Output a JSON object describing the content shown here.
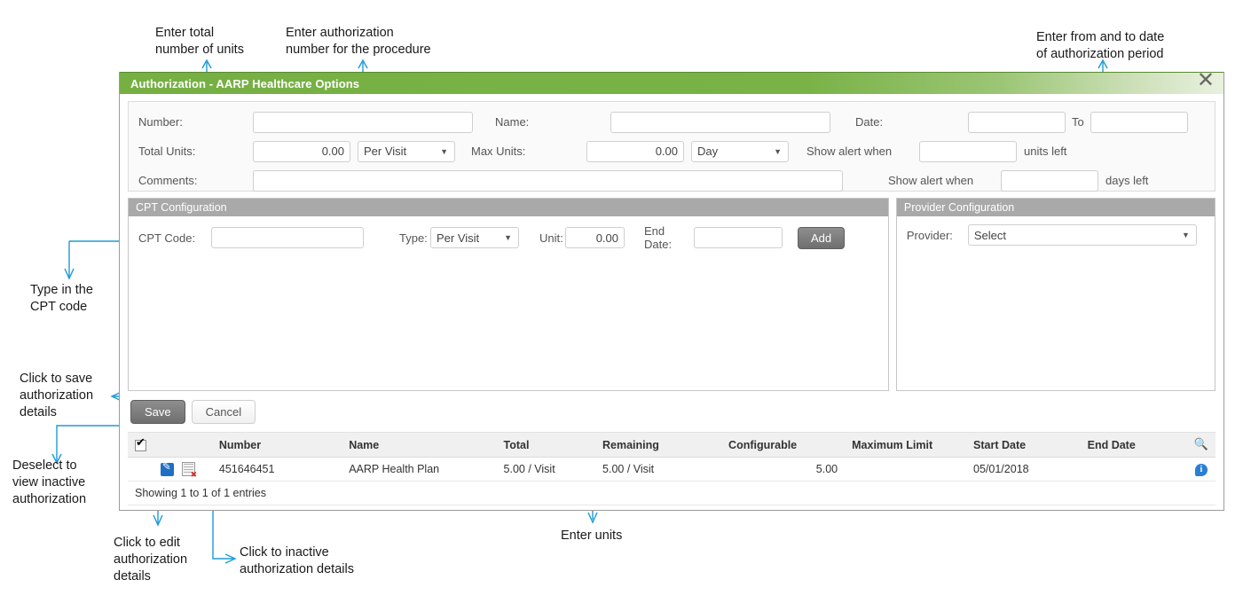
{
  "dialog": {
    "title": "Authorization - AARP Healthcare Options",
    "close_label": "✕",
    "form": {
      "number_label": "Number:",
      "number_value": "",
      "name_label": "Name:",
      "name_value": "",
      "date_label": "Date:",
      "date_from_value": "",
      "date_to_label": "To",
      "date_to_value": "",
      "total_units_label": "Total Units:",
      "total_units_value": "0.00",
      "total_units_period": "Per Visit",
      "max_units_label": "Max Units:",
      "max_units_value": "0.00",
      "max_units_period": "Day",
      "alert_units_label": "Show alert when",
      "alert_units_value": "",
      "alert_units_suffix": "units left",
      "alert_days_label": "Show alert when",
      "alert_days_value": "",
      "alert_days_suffix": "days left",
      "comments_label": "Comments:",
      "comments_value": ""
    },
    "cpt_config": {
      "title": "CPT Configuration",
      "cpt_code_label": "CPT Code:",
      "cpt_code_value": "",
      "type_label": "Type:",
      "type_value": "Per Visit",
      "unit_label": "Unit:",
      "unit_value": "0.00",
      "end_date_label": "End Date:",
      "end_date_value": "",
      "add_label": "Add"
    },
    "provider_config": {
      "title": "Provider Configuration",
      "provider_label": "Provider:",
      "provider_value": "Select"
    },
    "actions": {
      "save_label": "Save",
      "cancel_label": "Cancel"
    },
    "table": {
      "columns": [
        "",
        "Number",
        "Name",
        "Total",
        "Remaining",
        "Configurable",
        "Maximum Limit",
        "Start Date",
        "End Date",
        ""
      ],
      "header_checkbox_checked": true,
      "search_icon": "search-icon",
      "rows": [
        {
          "number": "451646451",
          "name": "AARP Health Plan",
          "total": "5.00 / Visit",
          "remaining": "5.00 / Visit",
          "configurable": "5.00",
          "maximum_limit": "",
          "start_date": "05/01/2018",
          "end_date": "",
          "edit_icon": "edit-icon",
          "inactivate_icon": "inactivate-icon",
          "info_icon": "info-icon"
        }
      ],
      "footer": "Showing 1 to 1 of 1 entries"
    }
  },
  "annotations": [
    {
      "id": "total-units",
      "text": "Enter total\nnumber of units"
    },
    {
      "id": "auth-number",
      "text": "Enter authorization\nnumber for the procedure"
    },
    {
      "id": "auth-period",
      "text": "Enter from and to date\nof authorization period"
    },
    {
      "id": "cpt-code",
      "text": "Type in the\nCPT code"
    },
    {
      "id": "save",
      "text": "Click to save\nauthorization\ndetails"
    },
    {
      "id": "deselect",
      "text": "Deselect to\nview inactive\nauthorization"
    },
    {
      "id": "edit",
      "text": "Click to edit\nauthorization\ndetails"
    },
    {
      "id": "inactive",
      "text": "Click to inactive\nauthorization details"
    },
    {
      "id": "units",
      "text": "Enter units"
    }
  ],
  "colors": {
    "title_green": "#76b043",
    "panel_header_grey": "#a9a9a9",
    "annotation_line": "#1f9ad6",
    "edit_icon_blue": "#1f6fc4",
    "info_icon_blue": "#2a7fd4"
  }
}
